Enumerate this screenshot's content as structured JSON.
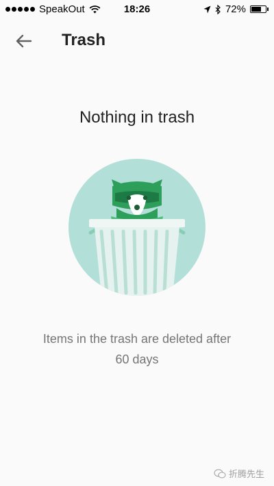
{
  "status_bar": {
    "carrier": "SpeakOut",
    "time": "18:26",
    "battery": "72%",
    "battery_level": 0.72
  },
  "header": {
    "title": "Trash",
    "back_icon": "arrow-back-icon"
  },
  "empty_state": {
    "title": "Nothing in trash",
    "message_line1": "Items in the trash are deleted after",
    "message_line2": "60 days",
    "illustration": "raccoon-in-trash-can",
    "colors": {
      "circle": "#b3dfd9",
      "raccoon": "#2e9e5b",
      "can": "#e6f2ef"
    }
  },
  "watermark": {
    "text": "折腾先生"
  }
}
